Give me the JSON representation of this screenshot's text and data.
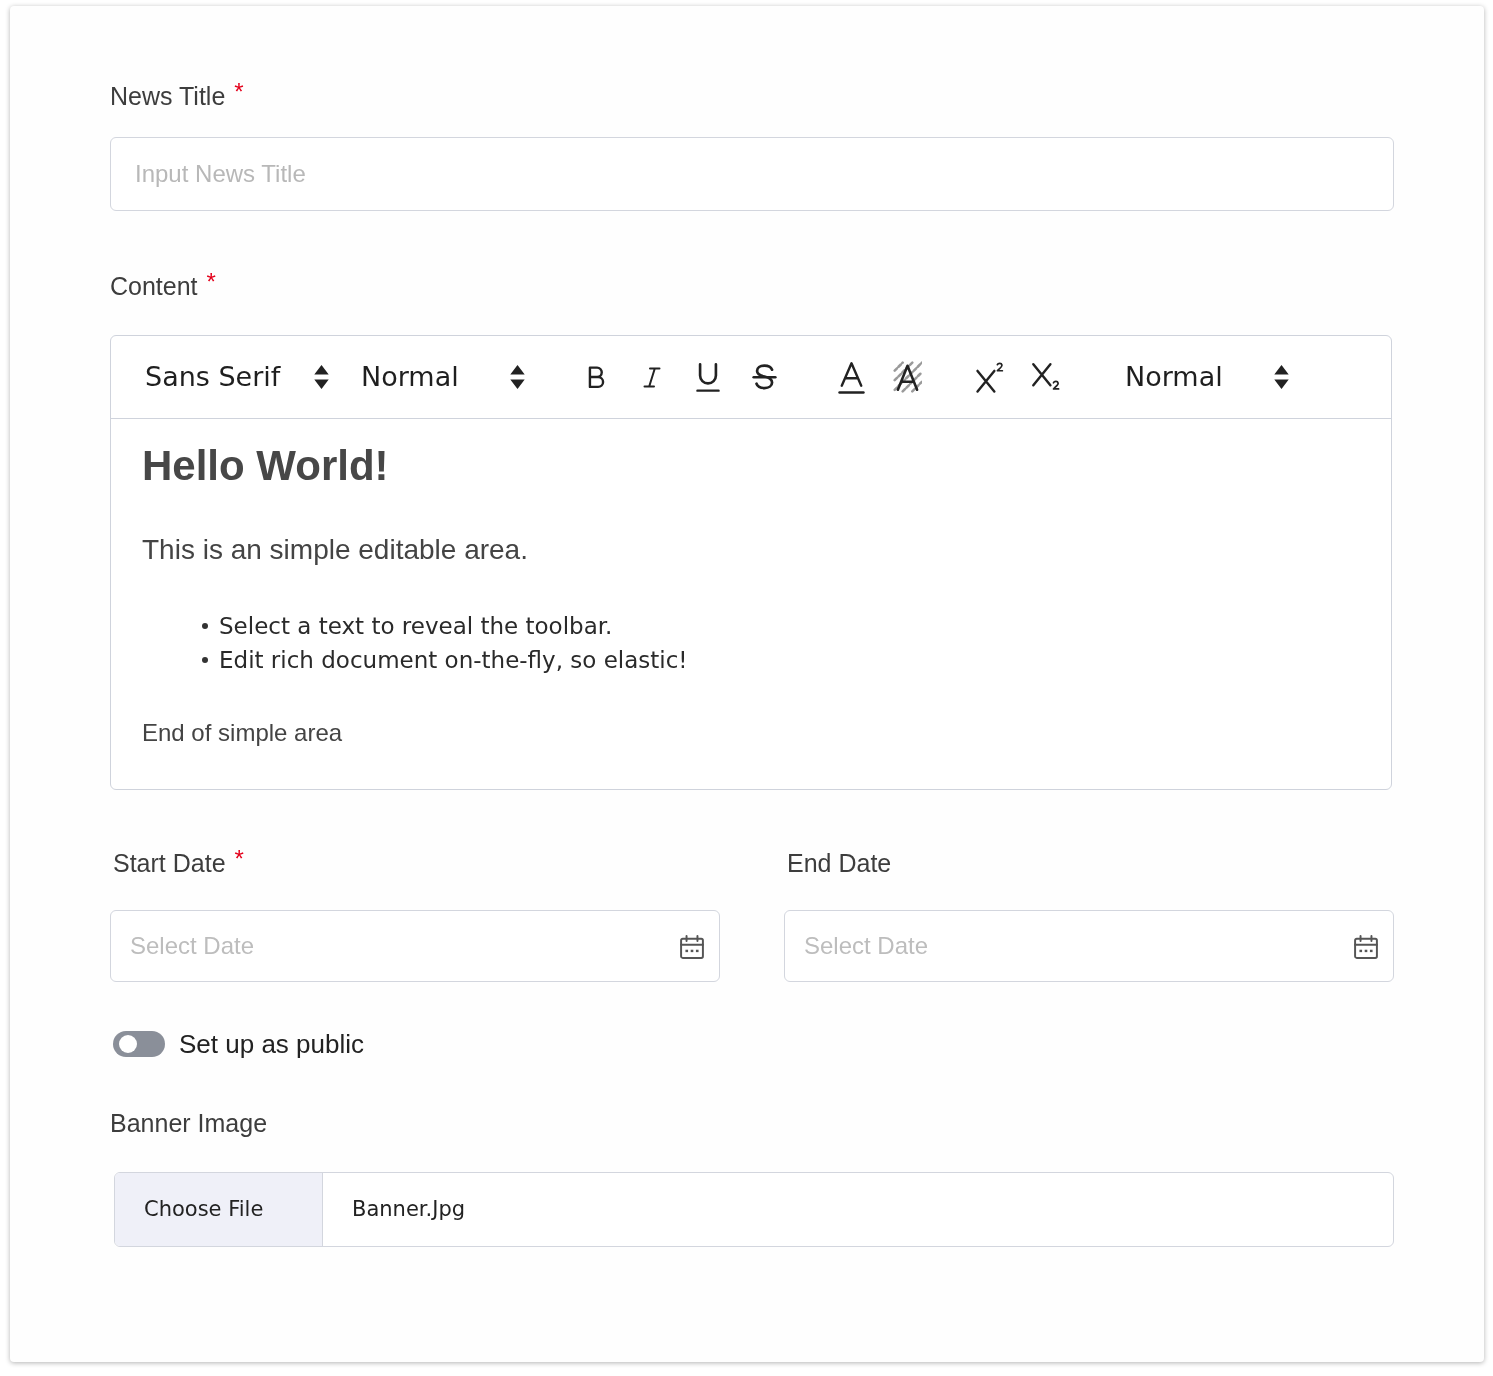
{
  "news_title": {
    "label": "News Title",
    "required_mark": "*",
    "placeholder": "Input News Title"
  },
  "content": {
    "label": "Content",
    "required_mark": "*",
    "toolbar_groups": [
      {
        "items": [
          {
            "kind": "font",
            "value": "Sans Serif"
          },
          {
            "kind": "size",
            "value": "Normal"
          }
        ]
      },
      {
        "items": [
          {
            "kind": "bold"
          },
          {
            "kind": "italic"
          },
          {
            "kind": "underline"
          },
          {
            "kind": "strike"
          }
        ]
      },
      {
        "items": [
          {
            "kind": "color"
          },
          {
            "kind": "background"
          }
        ]
      },
      {
        "items": [
          {
            "kind": "superscript"
          },
          {
            "kind": "subscript"
          }
        ]
      },
      {
        "items": [
          {
            "kind": "header",
            "value": "Normal"
          }
        ]
      }
    ],
    "body": [
      {
        "kind": "heading",
        "text": "Hello World!"
      },
      {
        "kind": "lead",
        "text": "This is an simple editable area."
      },
      {
        "kind": "list",
        "items": [
          "Select a text to reveal the toolbar.",
          "Edit rich document on-the-fly, so elastic!"
        ]
      },
      {
        "kind": "paragraph",
        "text": "End of simple area"
      }
    ]
  },
  "dates": [
    {
      "label": "Start Date",
      "required_mark": "*",
      "placeholder": "Select Date"
    },
    {
      "label": "End Date",
      "placeholder": "Select Date"
    }
  ],
  "public_toggle": {
    "label": "Set up as public",
    "on": false
  },
  "banner_image": {
    "label": "Banner Image",
    "button": "Choose File",
    "file_name": "Banner.Jpg"
  }
}
